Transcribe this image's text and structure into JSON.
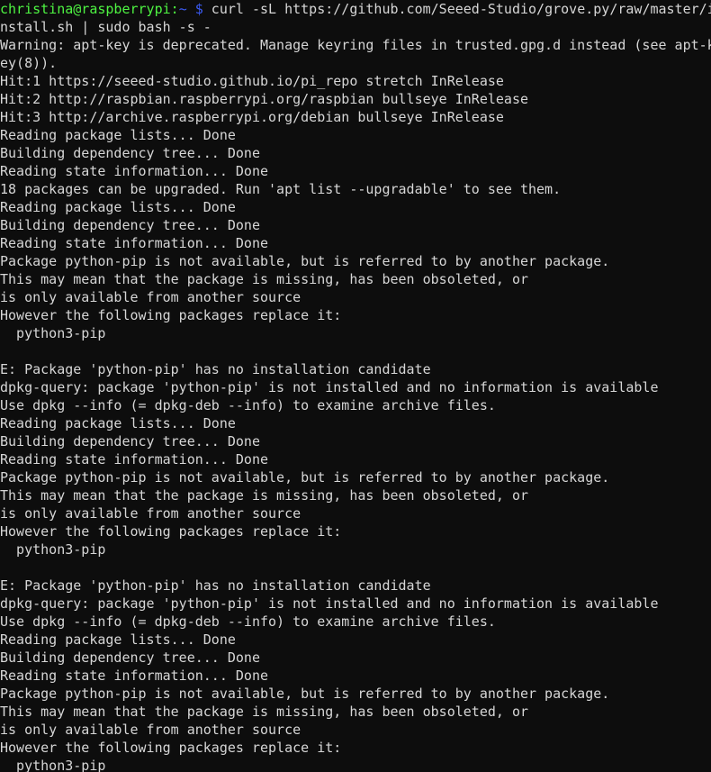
{
  "terminal": {
    "window_title": "christina@raspberrypi: ~",
    "colors": {
      "background": "#0d0d0d",
      "foreground": "#d6d6d6",
      "prompt_user_host": "#4ef442",
      "prompt_path": "#3b5bf5",
      "prompt_symbol": "#3b5bf5"
    },
    "prompt": {
      "user_host": "christina@raspberrypi",
      "colon": ":",
      "path": "~",
      "symbol": "$"
    },
    "command": " curl -sL https://github.com/Seeed-Studio/grove.py/raw/master/install.sh | sudo bash -s -",
    "lines": [
      {
        "type": "prompt",
        "user_host": "christina@raspberrypi",
        "colon": ":",
        "path": "~",
        "symbol": "$",
        "command": " curl -sL https://github.com/Seeed-Studio/grove.py/raw/master/i"
      },
      {
        "type": "output",
        "text": "nstall.sh | sudo bash -s -"
      },
      {
        "type": "output",
        "text": "Warning: apt-key is deprecated. Manage keyring files in trusted.gpg.d instead (see apt-k"
      },
      {
        "type": "output",
        "text": "ey(8))."
      },
      {
        "type": "output",
        "text": "Hit:1 https://seeed-studio.github.io/pi_repo stretch InRelease"
      },
      {
        "type": "output",
        "text": "Hit:2 http://raspbian.raspberrypi.org/raspbian bullseye InRelease"
      },
      {
        "type": "output",
        "text": "Hit:3 http://archive.raspberrypi.org/debian bullseye InRelease"
      },
      {
        "type": "output",
        "text": "Reading package lists... Done"
      },
      {
        "type": "output",
        "text": "Building dependency tree... Done"
      },
      {
        "type": "output",
        "text": "Reading state information... Done"
      },
      {
        "type": "output",
        "text": "18 packages can be upgraded. Run 'apt list --upgradable' to see them."
      },
      {
        "type": "output",
        "text": "Reading package lists... Done"
      },
      {
        "type": "output",
        "text": "Building dependency tree... Done"
      },
      {
        "type": "output",
        "text": "Reading state information... Done"
      },
      {
        "type": "output",
        "text": "Package python-pip is not available, but is referred to by another package."
      },
      {
        "type": "output",
        "text": "This may mean that the package is missing, has been obsoleted, or"
      },
      {
        "type": "output",
        "text": "is only available from another source"
      },
      {
        "type": "output",
        "text": "However the following packages replace it:"
      },
      {
        "type": "output",
        "text": "  python3-pip"
      },
      {
        "type": "output",
        "text": ""
      },
      {
        "type": "output",
        "text": "E: Package 'python-pip' has no installation candidate"
      },
      {
        "type": "output",
        "text": "dpkg-query: package 'python-pip' is not installed and no information is available"
      },
      {
        "type": "output",
        "text": "Use dpkg --info (= dpkg-deb --info) to examine archive files."
      },
      {
        "type": "output",
        "text": "Reading package lists... Done"
      },
      {
        "type": "output",
        "text": "Building dependency tree... Done"
      },
      {
        "type": "output",
        "text": "Reading state information... Done"
      },
      {
        "type": "output",
        "text": "Package python-pip is not available, but is referred to by another package."
      },
      {
        "type": "output",
        "text": "This may mean that the package is missing, has been obsoleted, or"
      },
      {
        "type": "output",
        "text": "is only available from another source"
      },
      {
        "type": "output",
        "text": "However the following packages replace it:"
      },
      {
        "type": "output",
        "text": "  python3-pip"
      },
      {
        "type": "output",
        "text": ""
      },
      {
        "type": "output",
        "text": "E: Package 'python-pip' has no installation candidate"
      },
      {
        "type": "output",
        "text": "dpkg-query: package 'python-pip' is not installed and no information is available"
      },
      {
        "type": "output",
        "text": "Use dpkg --info (= dpkg-deb --info) to examine archive files."
      },
      {
        "type": "output",
        "text": "Reading package lists... Done"
      },
      {
        "type": "output",
        "text": "Building dependency tree... Done"
      },
      {
        "type": "output",
        "text": "Reading state information... Done"
      },
      {
        "type": "output",
        "text": "Package python-pip is not available, but is referred to by another package."
      },
      {
        "type": "output",
        "text": "This may mean that the package is missing, has been obsoleted, or"
      },
      {
        "type": "output",
        "text": "is only available from another source"
      },
      {
        "type": "output",
        "text": "However the following packages replace it:"
      },
      {
        "type": "output",
        "text": "  python3-pip"
      }
    ]
  }
}
